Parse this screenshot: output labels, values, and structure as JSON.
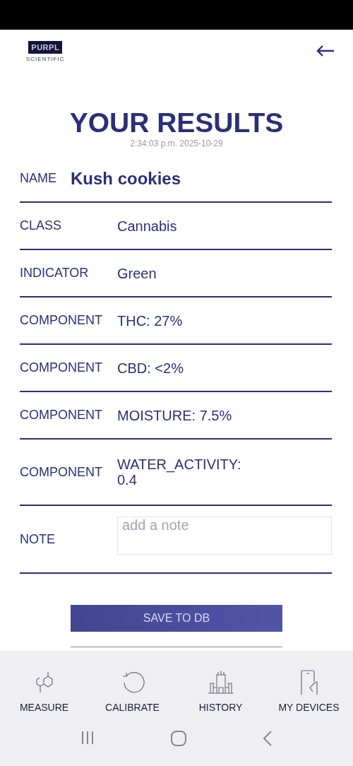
{
  "logo": {
    "brand": "PURPL",
    "tagline": "SCIENTIFIC"
  },
  "title": "YOUR RESULTS",
  "timestamp": "2:34:03 p.m. 2025-10-29",
  "fields": [
    {
      "kind": "name",
      "label": "NAME",
      "value": "Kush cookies"
    },
    {
      "kind": "text",
      "label": "CLASS",
      "value": "Cannabis"
    },
    {
      "kind": "text",
      "label": "INDICATOR",
      "value": "Green"
    },
    {
      "kind": "text",
      "label": "COMPONENT",
      "value": "THC: 27%"
    },
    {
      "kind": "text",
      "label": "COMPONENT",
      "value": "CBD: <2%"
    },
    {
      "kind": "text",
      "label": "COMPONENT",
      "value": "MOISTURE: 7.5%"
    },
    {
      "kind": "text",
      "label": "COMPONENT",
      "value": "WATER_ACTIVITY: 0.4"
    },
    {
      "kind": "input",
      "label": "NOTE",
      "placeholder": "add a note"
    }
  ],
  "save_button": "SAVE TO DB",
  "nav": [
    {
      "kind": "measure",
      "label": "MEASURE",
      "selected": false
    },
    {
      "kind": "calibrate",
      "label": "CALIBRATE",
      "selected": false
    },
    {
      "kind": "history",
      "label": "HISTORY",
      "selected": false
    },
    {
      "kind": "devices",
      "label": "MY DEVICES",
      "selected": false
    }
  ]
}
